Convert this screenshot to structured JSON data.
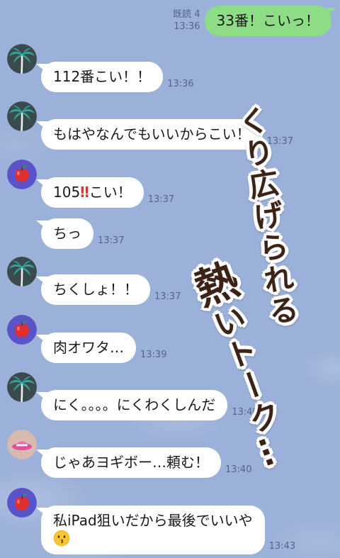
{
  "theme": {
    "background": "#9cb1d9",
    "sent_bubble": "#8edd86",
    "received_bubble": "#ffffff",
    "meta_text": "#56638a",
    "overlay_fill": "#3a2216",
    "emphasis_red": "#e2302b"
  },
  "sent_message": {
    "text": "33番！こいっ！",
    "read_status": "既読 4",
    "time": "13:36"
  },
  "received_messages": [
    {
      "avatar_icon": "palm-tree",
      "text": "112番こい！！",
      "time": "13:36"
    },
    {
      "avatar_icon": "palm-tree",
      "text": "もはやなんでもいいからこい！",
      "time": "13:37"
    },
    {
      "avatar_icon": "red-apple",
      "parts": [
        "105",
        "‼",
        "こい！"
      ],
      "time": "13:37"
    },
    {
      "text": "ちっ",
      "time": "13:37"
    },
    {
      "avatar_icon": "palm-tree",
      "text": "ちくしょ！！",
      "time": "13:37"
    },
    {
      "avatar_icon": "red-apple",
      "text": "肉オワタ…",
      "time": "13:39"
    },
    {
      "avatar_icon": "palm-tree",
      "text": "にく。。。。にくわくしんだ",
      "time": "13:40"
    },
    {
      "avatar_icon": "pink-hat",
      "text": "じゃあヨギボー…頼む！",
      "time": "13:40"
    },
    {
      "avatar_icon": "red-apple",
      "text": "私iPad狙いだから最後でいいや",
      "emoji_icon": "kissing-face",
      "time": "13:43"
    }
  ],
  "overlay_caption": {
    "line1": "くり広げられる",
    "line2": "熱いトーク…"
  }
}
